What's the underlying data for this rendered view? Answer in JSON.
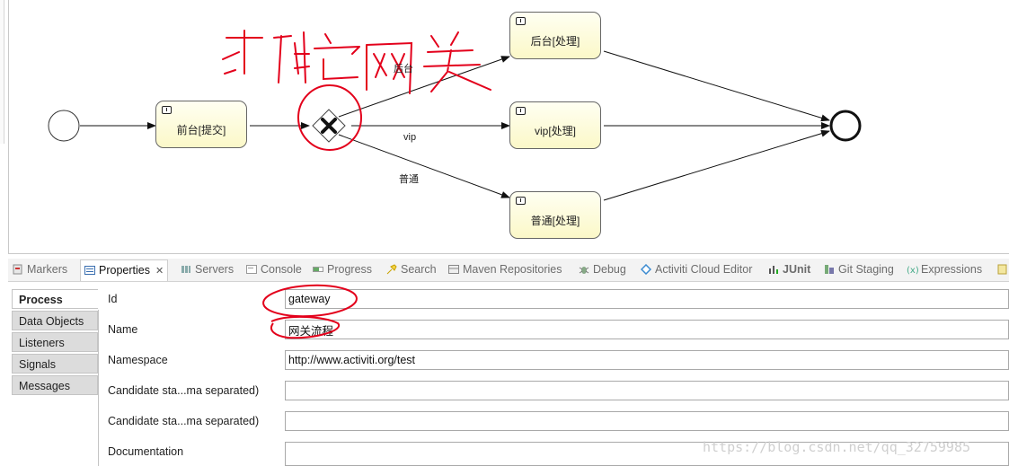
{
  "diagram": {
    "tasks": [
      {
        "label": "前台[提交]"
      },
      {
        "label": "后台[处理]"
      },
      {
        "label": "vip[处理]"
      },
      {
        "label": "普通[处理]"
      }
    ],
    "flows": [
      {
        "label": "后台"
      },
      {
        "label": "vip"
      },
      {
        "label": "普通"
      }
    ],
    "annotation_text": "排它网关"
  },
  "tabs": [
    {
      "label": "Markers",
      "icon": "markers-icon"
    },
    {
      "label": "Properties",
      "icon": "properties-icon",
      "active": true
    },
    {
      "label": "Servers",
      "icon": "servers-icon"
    },
    {
      "label": "Console",
      "icon": "console-icon"
    },
    {
      "label": "Progress",
      "icon": "progress-icon"
    },
    {
      "label": "Search",
      "icon": "search-icon"
    },
    {
      "label": "Maven Repositories",
      "icon": "maven-icon"
    },
    {
      "label": "Debug",
      "icon": "debug-icon"
    },
    {
      "label": "Activiti Cloud Editor",
      "icon": "activiti-icon"
    },
    {
      "label": "JUnit",
      "icon": "junit-icon"
    },
    {
      "label": "Git Staging",
      "icon": "git-icon"
    },
    {
      "label": "Expressions",
      "icon": "expressions-icon"
    }
  ],
  "sidebar": {
    "items": [
      {
        "label": "Process"
      },
      {
        "label": "Data Objects"
      },
      {
        "label": "Listeners"
      },
      {
        "label": "Signals"
      },
      {
        "label": "Messages"
      }
    ]
  },
  "properties": {
    "id_label": "Id",
    "id_value": "gateway",
    "name_label": "Name",
    "name_value": "网关流程",
    "namespace_label": "Namespace",
    "namespace_value": "http://www.activiti.org/test",
    "candidate1_label": "Candidate sta...ma separated)",
    "candidate1_value": "",
    "candidate2_label": "Candidate sta...ma separated)",
    "candidate2_value": "",
    "documentation_label": "Documentation",
    "documentation_value": ""
  },
  "watermark": "https://blog.csdn.net/qq_32759985",
  "colors": {
    "task_fill": "#fbf8c8",
    "annotation_red": "#e3001b"
  }
}
